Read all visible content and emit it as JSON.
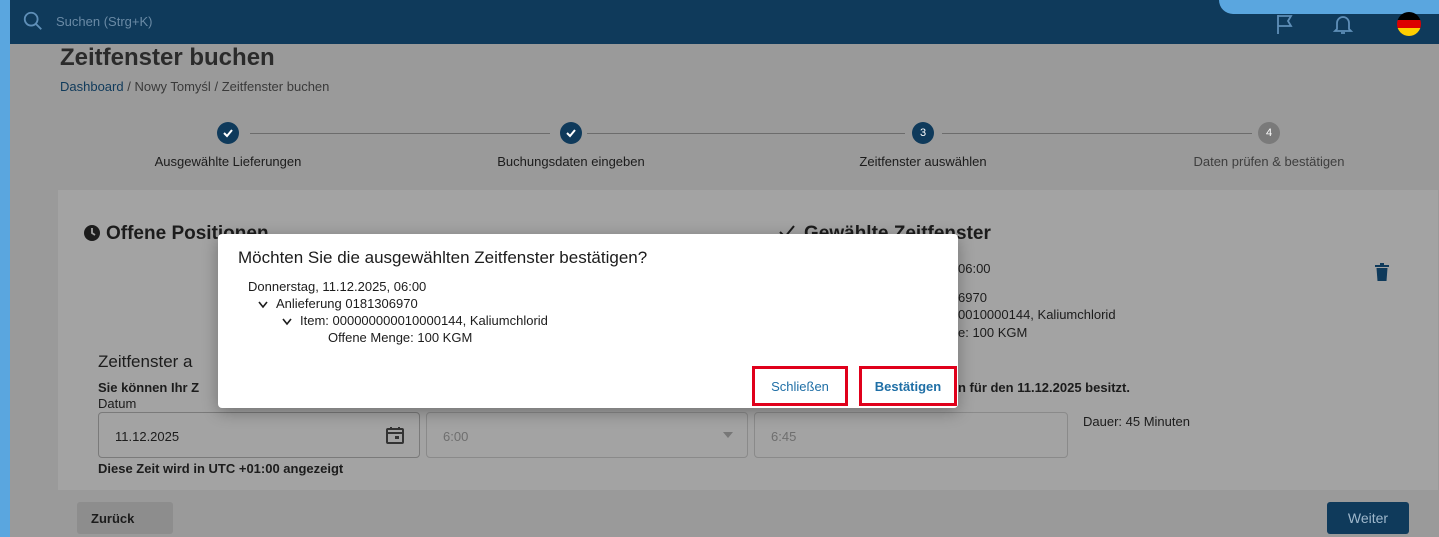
{
  "topbar": {
    "search_placeholder": "Suchen (Strg+K)"
  },
  "page": {
    "title": "Zeitfenster buchen"
  },
  "breadcrumb": {
    "home": "Dashboard",
    "separator": "/",
    "location": "Nowy Tomyśl",
    "current": "Zeitfenster buchen"
  },
  "steps": [
    {
      "label": "Ausgewählte Lieferungen",
      "state": "done"
    },
    {
      "label": "Buchungsdaten eingeben",
      "state": "done"
    },
    {
      "label": "Zeitfenster auswählen",
      "number": "3",
      "state": "active"
    },
    {
      "label": "Daten prüfen & bestätigen",
      "number": "4",
      "state": "pending"
    }
  ],
  "open_positions": {
    "title": "Offene Positionen"
  },
  "selected": {
    "title": "Gewählte Zeitfenster",
    "time": "06:00",
    "delivery": "6970",
    "item": "0010000144, Kaliumchlorid",
    "qty": "e: 100 KGM"
  },
  "timewindow": {
    "title": "Zeitfenster a",
    "info_prefix": "Sie können Ihr Z",
    "info_suffix": "n für den 11.12.2025 besitzt.",
    "date_label": "Datum",
    "date_value": "11.12.2025",
    "start_value": "6:00",
    "end_value": "6:45",
    "duration": "Dauer: 45 Minuten",
    "timezone_note": "Diese Zeit wird in UTC +01:00 angezeigt"
  },
  "footer": {
    "back_label": "Zurück",
    "next_label": "Weiter"
  },
  "dialog": {
    "title": "Möchten Sie die ausgewählten Zeitfenster bestätigen?",
    "date_line": "Donnerstag, 11.12.2025, 06:00",
    "delivery_line": "Anlieferung 0181306970",
    "item_line": "Item: 000000000010000144, Kaliumchlorid",
    "qty_line": "Offene Menge: 100 KGM",
    "close_label": "Schließen",
    "confirm_label": "Bestätigen"
  },
  "colors": {
    "header": "#0f3a5b",
    "highlight": "#e0001b",
    "link": "#1f6fa6",
    "outer_border": "#5aa6df"
  }
}
